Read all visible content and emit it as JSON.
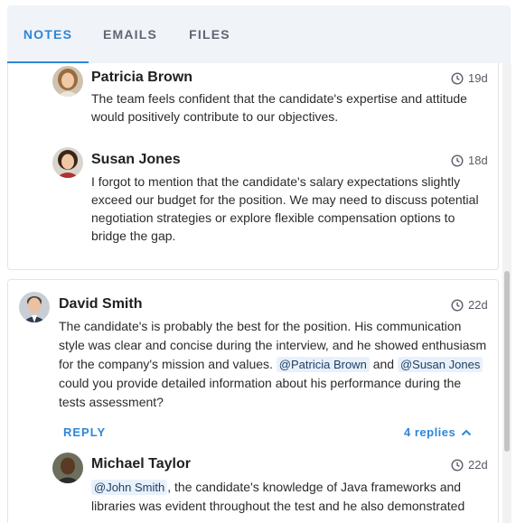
{
  "tabs": [
    {
      "label": "NOTES",
      "active": true
    },
    {
      "label": "EMAILS",
      "active": false
    },
    {
      "label": "FILES",
      "active": false
    }
  ],
  "replies_first": [
    {
      "author": "Patricia Brown",
      "time": "19d",
      "text": "The team feels confident that the candidate's expertise and attitude would positively contribute to our objectives."
    },
    {
      "author": "Susan Jones",
      "time": "18d",
      "text": "I forgot to mention that the candidate's salary expectations slightly exceed our budget for the position. We may need to discuss potential negotiation strategies or explore flexible compensation options to bridge the gap."
    }
  ],
  "note": {
    "author": "David Smith",
    "time": "22d",
    "text_part1": "The candidate's is probably the best for the position. His communication style was clear and concise during the interview, and he showed enthusiasm for the company's mission and values.",
    "mention1": "@Patricia Brown",
    "text_and": "and",
    "mention2": "@Susan Jones",
    "text_part2": "could you provide detailed information about his performance during the tests assessment?",
    "reply_label": "REPLY",
    "replies_label": "4 replies"
  },
  "reply_second": {
    "author": "Michael Taylor",
    "time": "22d",
    "mention": "@John Smith",
    "text": ", the candidate's knowledge of Java frameworks and libraries was evident throughout the test and he also demonstrated"
  },
  "colors": {
    "accent": "#2e86d6",
    "tab_bg": "#f0f3f8",
    "mention_bg": "#e8f1fb"
  },
  "icons": [
    "clock-icon",
    "chevron-up-icon",
    "avatar-photo"
  ]
}
